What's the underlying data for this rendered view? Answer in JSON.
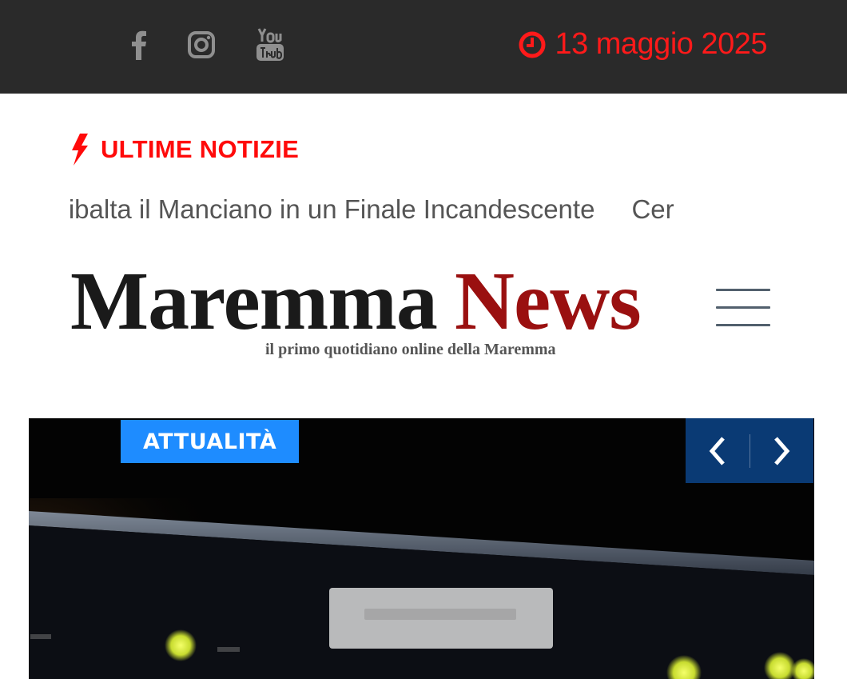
{
  "topbar": {
    "social": [
      {
        "icon": "facebook-icon",
        "label": "f"
      },
      {
        "icon": "instagram-icon"
      },
      {
        "icon": "youtube-icon"
      }
    ],
    "date": "13 maggio 2025",
    "accent_color": "#ff1a1a"
  },
  "breaking": {
    "label": "ULTIME NOTIZIE",
    "icon": "bolt-icon",
    "ticker": [
      "se Ribalta il Manciano in un Finale Incandescente",
      "Cer"
    ]
  },
  "logo": {
    "word1": "Maremma",
    "word2": "News",
    "tagline": "il primo quotidiano online della Maremma"
  },
  "menu": {
    "icon": "hamburger-menu-icon"
  },
  "hero": {
    "category": "ATTUALITÀ",
    "prev_icon": "chevron-left-icon",
    "next_icon": "chevron-right-icon",
    "badge_color": "#1e8cff",
    "nav_color": "#0a3a74"
  }
}
